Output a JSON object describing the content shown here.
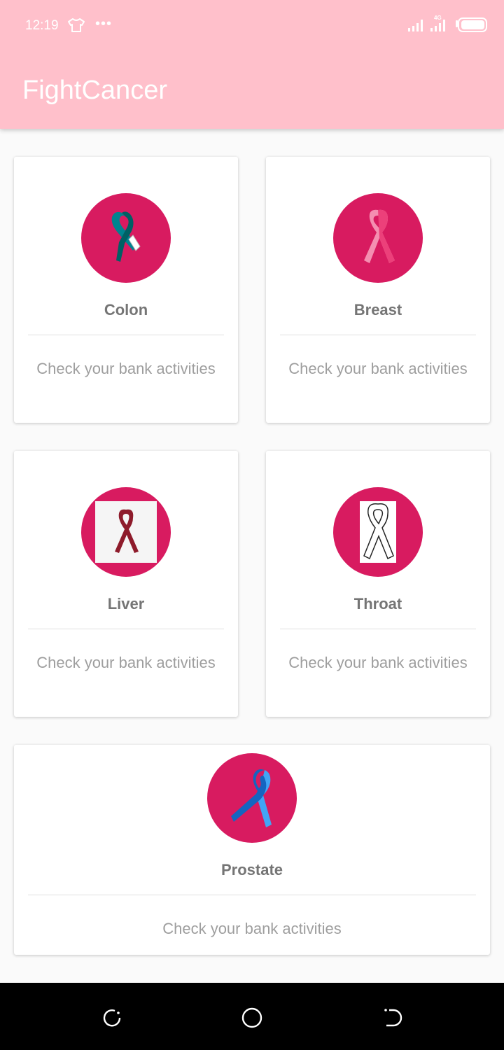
{
  "status_bar": {
    "time": "12:19",
    "icons": [
      "tshirt-icon",
      "more-dots-icon",
      "signal-icon",
      "signal-4g-icon",
      "battery-icon"
    ]
  },
  "app_bar": {
    "title": "FightCancer",
    "color": "#ffc0cb"
  },
  "cards": [
    {
      "title": "Colon",
      "subtitle": "Check your bank activities",
      "icon": "colon-ribbon-icon",
      "ribbon_color": "#00838f"
    },
    {
      "title": "Breast",
      "subtitle": "Check your bank activities",
      "icon": "breast-ribbon-icon",
      "ribbon_color": "#f06292"
    },
    {
      "title": "Liver",
      "subtitle": "Check your bank activities",
      "icon": "liver-ribbon-icon",
      "ribbon_color": "#8e1b2b"
    },
    {
      "title": "Throat",
      "subtitle": "Check your bank activities",
      "icon": "throat-ribbon-icon",
      "ribbon_color": "#ffffff"
    },
    {
      "title": "Prostate",
      "subtitle": "Check your bank activities",
      "icon": "prostate-ribbon-icon",
      "ribbon_color": "#42a5f5"
    }
  ],
  "accent_color": "#d81b60",
  "nav_bar": {
    "buttons": [
      "recent-apps-icon",
      "home-icon",
      "back-icon"
    ]
  }
}
